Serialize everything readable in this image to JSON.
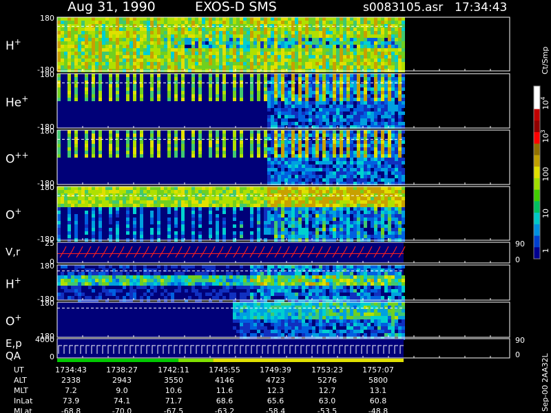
{
  "header": {
    "date": "Aug 31, 1990",
    "instrument": "EXOS-D SMS",
    "file": "s0083105.asr",
    "time": "17:34:43"
  },
  "footer_id": "Sep-00 2AA32L",
  "colorbar": {
    "unit_label": "Ct/Smp",
    "ticks": [
      {
        "label": "10",
        "sup": "4"
      },
      {
        "label": "10",
        "sup": "3"
      },
      {
        "label": "100",
        "sup": ""
      },
      {
        "label": "10",
        "sup": ""
      },
      {
        "label": "1",
        "sup": ""
      }
    ]
  },
  "chart_data": [
    {
      "type": "heatmap",
      "panel": "H+",
      "species": "H",
      "charge": "+",
      "y_ticks": [
        "180",
        "-180"
      ],
      "ylim": [
        -180,
        180
      ],
      "colors": [
        "#0000c8",
        "#00c8c8",
        "#78dc00",
        "#e6e600"
      ]
    },
    {
      "type": "heatmap",
      "panel": "He+",
      "species": "He",
      "charge": "+",
      "y_ticks": [
        "180",
        "-180"
      ],
      "ylim": [
        -180,
        180
      ]
    },
    {
      "type": "heatmap",
      "panel": "O++",
      "species": "O",
      "charge": "++",
      "y_ticks": [
        "180",
        "-180"
      ],
      "ylim": [
        -180,
        180
      ]
    },
    {
      "type": "heatmap",
      "panel": "O+",
      "species": "O",
      "charge": "+",
      "y_ticks": [
        "180",
        "-180"
      ],
      "ylim": [
        -180,
        180
      ]
    },
    {
      "type": "line",
      "panel": "V,r",
      "label": "V,r",
      "y_ticks": [
        "25",
        "0"
      ],
      "right_ticks": [
        "90",
        "0"
      ],
      "color": "#ff2020"
    },
    {
      "type": "heatmap",
      "panel": "H+ (2)",
      "species": "H",
      "charge": "+",
      "y_ticks": [
        "180",
        "-180"
      ],
      "ylim": [
        -180,
        180
      ]
    },
    {
      "type": "heatmap",
      "panel": "O+ (2)",
      "species": "O",
      "charge": "+",
      "y_ticks": [
        "180",
        "-180"
      ],
      "ylim": [
        -180,
        180
      ]
    },
    {
      "type": "line",
      "panel": "E,p QA",
      "label": "E,p",
      "label2": "QA",
      "y_ticks": [
        "4000",
        "0"
      ],
      "right_ticks": [
        "90",
        "0"
      ],
      "color": "#ffffff"
    }
  ],
  "ephemeris": {
    "rows": [
      {
        "name": "UT",
        "values": [
          "1734:43",
          "1738:27",
          "1742:11",
          "1745:55",
          "1749:39",
          "1753:23",
          "1757:07"
        ]
      },
      {
        "name": "ALT",
        "values": [
          "2338",
          "2943",
          "3550",
          "4146",
          "4723",
          "5276",
          "5800"
        ]
      },
      {
        "name": "MLT",
        "values": [
          "7.2",
          "9.0",
          "10.6",
          "11.6",
          "12.3",
          "12.7",
          "13.1"
        ]
      },
      {
        "name": "InLat",
        "values": [
          "73.9",
          "74.1",
          "71.7",
          "68.6",
          "65.6",
          "63.0",
          "60.8"
        ]
      },
      {
        "name": "MLat",
        "values": [
          "-68.8",
          "-70.0",
          "-67.5",
          "-63.2",
          "-58.4",
          "-53.5",
          "-48.8"
        ]
      }
    ]
  }
}
